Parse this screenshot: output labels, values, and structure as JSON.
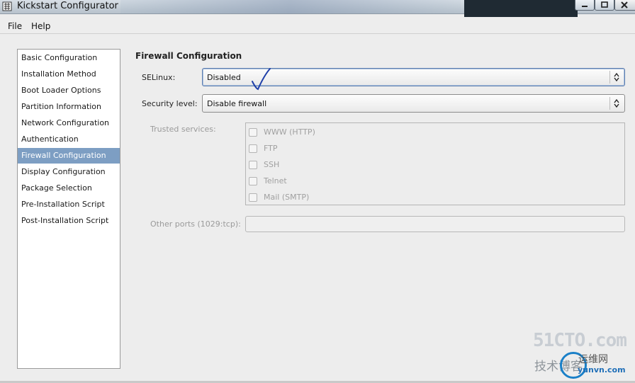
{
  "window": {
    "title": "Kickstart Configurator"
  },
  "menubar": {
    "file": "File",
    "help": "Help"
  },
  "sidebar": {
    "items": [
      {
        "label": "Basic Configuration",
        "selected": false
      },
      {
        "label": "Installation Method",
        "selected": false
      },
      {
        "label": "Boot Loader Options",
        "selected": false
      },
      {
        "label": "Partition Information",
        "selected": false
      },
      {
        "label": "Network Configuration",
        "selected": false
      },
      {
        "label": "Authentication",
        "selected": false
      },
      {
        "label": "Firewall Configuration",
        "selected": true
      },
      {
        "label": "Display Configuration",
        "selected": false
      },
      {
        "label": "Package Selection",
        "selected": false
      },
      {
        "label": "Pre-Installation Script",
        "selected": false
      },
      {
        "label": "Post-Installation Script",
        "selected": false
      }
    ]
  },
  "main": {
    "section_title": "Firewall Configuration",
    "selinux": {
      "label": "SELinux:",
      "value": "Disabled"
    },
    "security_level": {
      "label": "Security level:",
      "value": "Disable firewall"
    },
    "trusted_services": {
      "label": "Trusted services:",
      "services": [
        {
          "label": "WWW (HTTP)",
          "checked": false
        },
        {
          "label": "FTP",
          "checked": false
        },
        {
          "label": "SSH",
          "checked": false
        },
        {
          "label": "Telnet",
          "checked": false
        },
        {
          "label": "Mail (SMTP)",
          "checked": false
        }
      ]
    },
    "other_ports": {
      "label": "Other ports (1029:tcp):",
      "value": ""
    }
  },
  "watermark": {
    "line1": "51CTO.com",
    "line2": "技术博客",
    "line3": "运维网",
    "line4": "yunvn.com"
  },
  "colors": {
    "selection": "#7d9ec3",
    "focus_border": "#5e7fb0",
    "annotation": "#1f3fa8"
  }
}
